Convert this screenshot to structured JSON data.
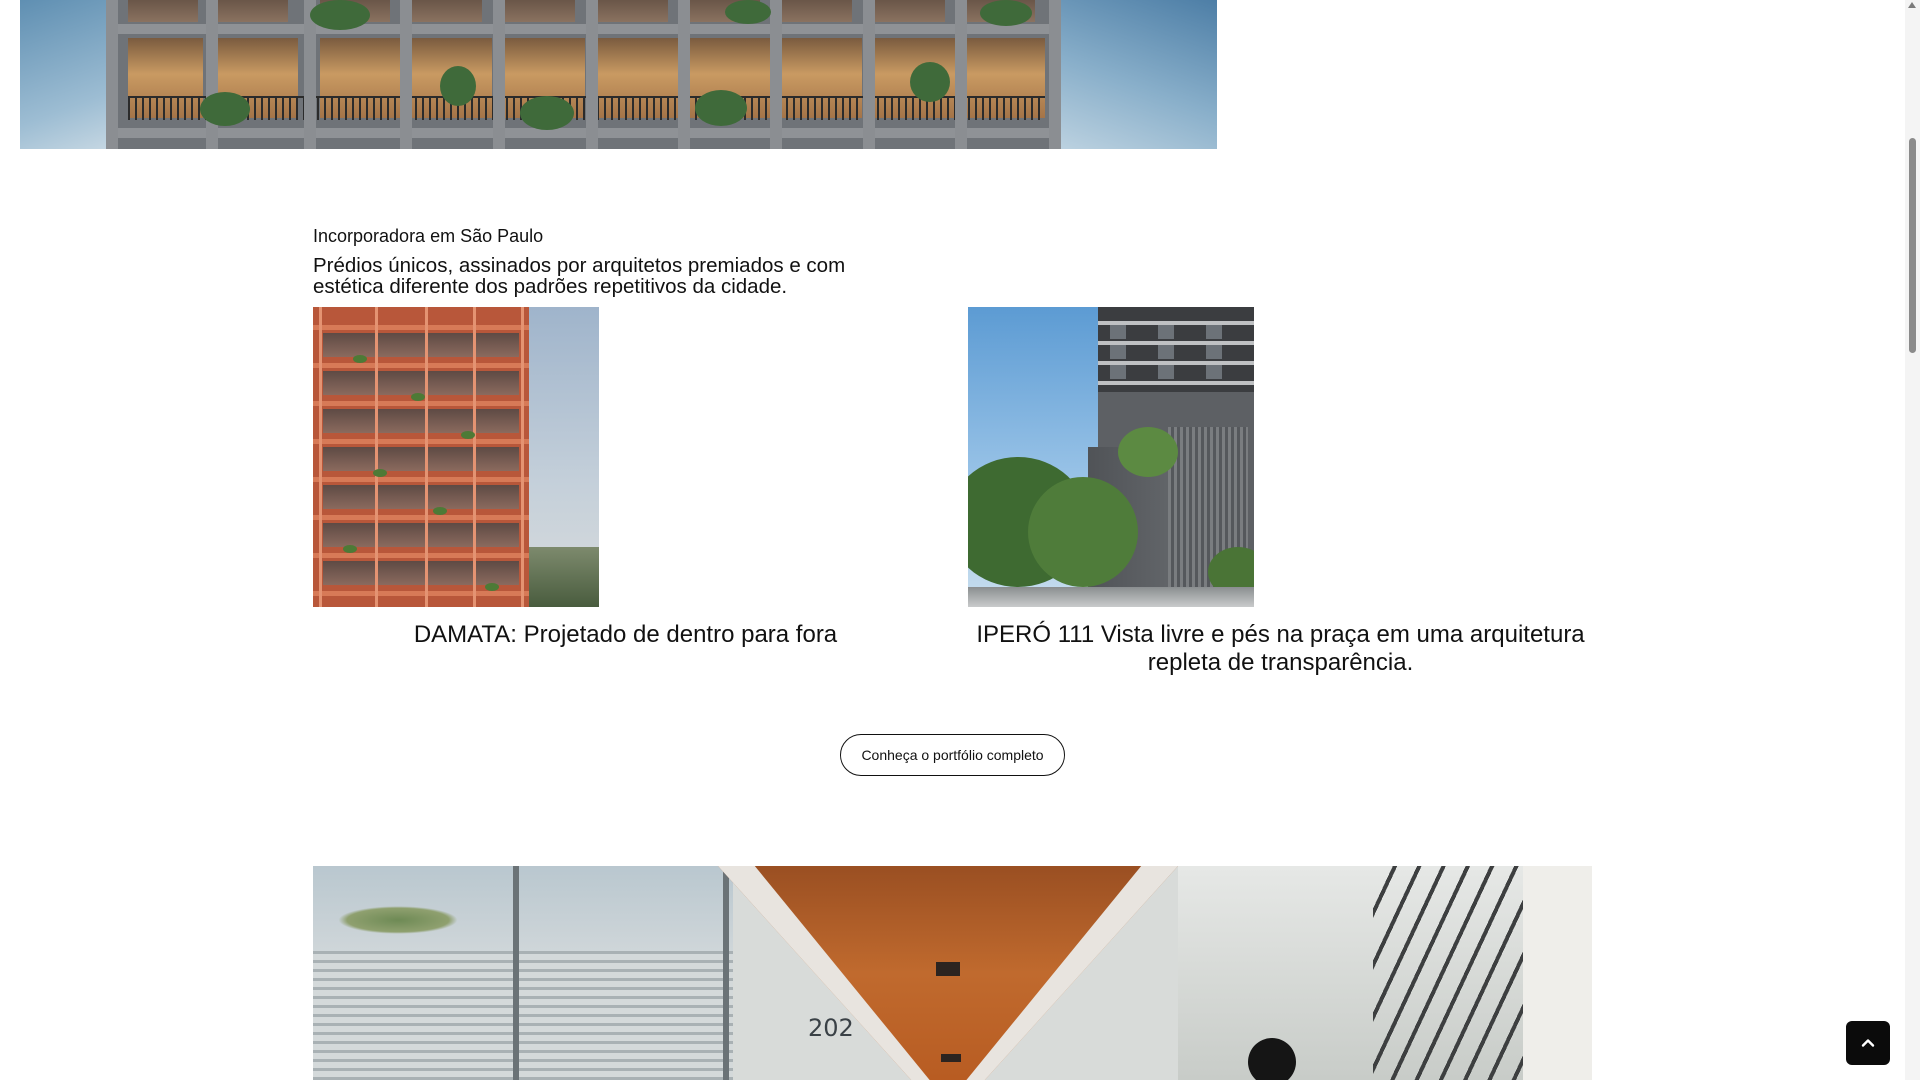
{
  "intro": {
    "eyebrow": "Incorporadora em São Paulo",
    "headline": "Prédios únicos, assinados por arquitetos premiados e com estética diferente dos padrões repetitivos da cidade."
  },
  "projects": [
    {
      "caption": "DAMATA: Projetado de dentro para fora"
    },
    {
      "caption": "IPERÓ 111 Vista livre e pés na praça em uma arquitetura repleta de transparência."
    }
  ],
  "portfolio_button": {
    "label": "Conheça o portfólio completo"
  },
  "lower_image": {
    "sign_text": "202"
  },
  "icons": {
    "back_to_top": "chevron-up-icon",
    "scroll_up": "triangle-up-icon"
  }
}
